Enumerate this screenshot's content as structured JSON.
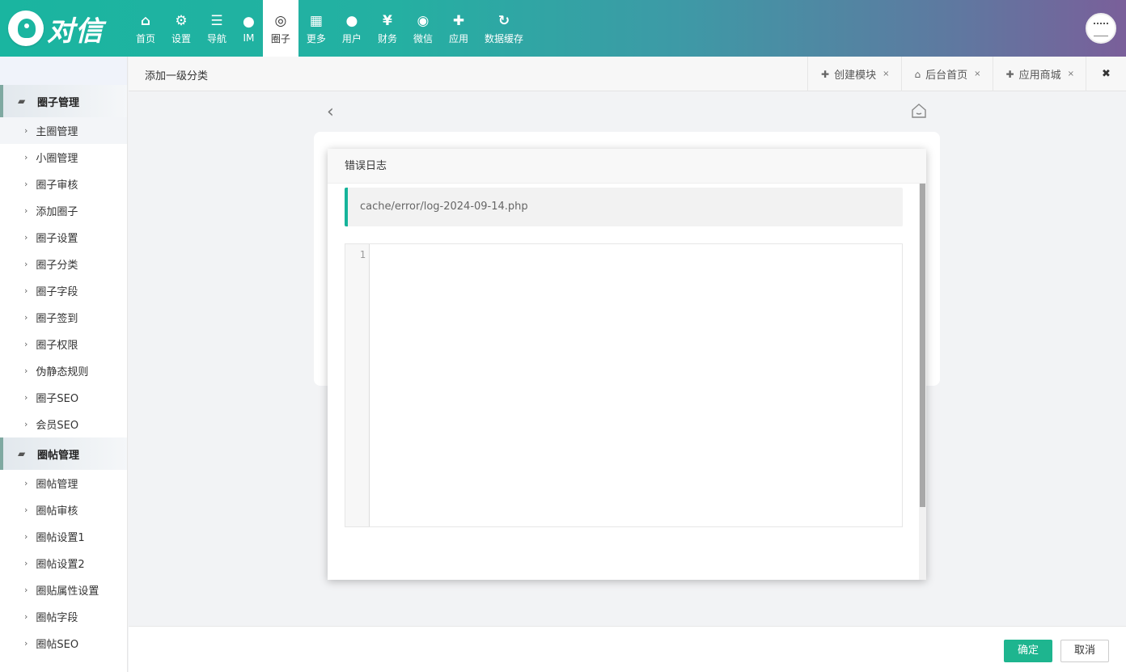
{
  "brand": {
    "logo_text": "对信"
  },
  "nav": [
    {
      "label": "首页",
      "icon": "home-icon",
      "glyph": "⌂"
    },
    {
      "label": "设置",
      "icon": "gears-icon",
      "glyph": "⚙"
    },
    {
      "label": "导航",
      "icon": "bars-icon",
      "glyph": "☰"
    },
    {
      "label": "IM",
      "icon": "chat-bubble-icon",
      "glyph": "●"
    },
    {
      "label": "圈子",
      "icon": "chat-bubbles-icon",
      "glyph": "◎"
    },
    {
      "label": "更多",
      "icon": "grid-icon",
      "glyph": "▦"
    },
    {
      "label": "用户",
      "icon": "user-icon",
      "glyph": "●"
    },
    {
      "label": "财务",
      "icon": "yen-icon",
      "glyph": "¥"
    },
    {
      "label": "微信",
      "icon": "wechat-icon",
      "glyph": "◉"
    },
    {
      "label": "应用",
      "icon": "puzzle-icon",
      "glyph": "✚"
    },
    {
      "label": "数据缓存",
      "icon": "refresh-icon",
      "glyph": "↻"
    }
  ],
  "nav_active_index": 4,
  "sidebar": {
    "groups": [
      {
        "title": "圈子管理",
        "items": [
          "主圈管理",
          "小圈管理",
          "圈子审核",
          "添加圈子",
          "圈子设置",
          "圈子分类",
          "圈子字段",
          "圈子签到",
          "圈子权限",
          "伪静态规则",
          "圈子SEO",
          "会员SEO"
        ]
      },
      {
        "title": "圈帖管理",
        "items": [
          "圈帖管理",
          "圈帖审核",
          "圈帖设置1",
          "圈帖设置2",
          "圈贴属性设置",
          "圈帖字段",
          "圈帖SEO"
        ]
      }
    ],
    "active_item": "主圈管理"
  },
  "tabbar": {
    "breadcrumb": "添加一级分类",
    "tabs": [
      {
        "label": "创建模块",
        "icon": "plus-icon",
        "glyph": "✚"
      },
      {
        "label": "后台首页",
        "icon": "home-icon",
        "glyph": "⌂"
      },
      {
        "label": "应用商城",
        "icon": "puzzle-icon",
        "glyph": "✚"
      }
    ],
    "close_glyph": "×",
    "close_all_glyph": "✖"
  },
  "modal": {
    "title": "错误日志",
    "file_path": "cache/error/log-2024-09-14.php",
    "line_number": "1"
  },
  "footer": {
    "ok_label": "确定",
    "cancel_label": "取消"
  },
  "colors": {
    "accent": "#1eb58f",
    "header_gradient_start": "#1ab5a0",
    "header_gradient_end": "#7a5f9a"
  }
}
